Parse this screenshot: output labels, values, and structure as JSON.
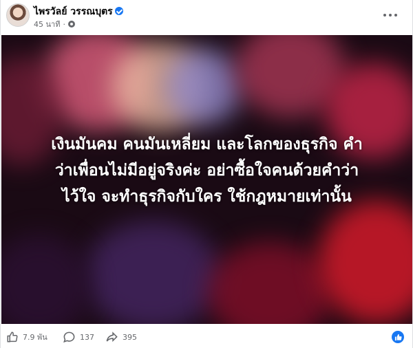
{
  "post": {
    "author": "ไพรวัลย์ วรรณบุตร",
    "time": "45 นาที",
    "separator": "·",
    "image_text_lines": [
      "เงินมันคม คนมันเหลี่ยม และโลกของธุรกิจ คำ",
      "ว่าเพื่อนไม่มีอยู่จริงค่ะ อย่าซื้อใจคนด้วยคำว่า",
      "ไว้ใจ จะทำธุรกิจกับใคร ใช้กฎหมายเท่านั้น"
    ]
  },
  "stats": {
    "likes": "7.9 พัน",
    "comments": "137",
    "shares": "395"
  },
  "icons": {
    "verified": "verified-badge-icon",
    "privacy": "globe-icon",
    "more": "more-options-icon",
    "like": "thumbs-up-icon",
    "comment": "comment-bubble-icon",
    "share": "share-arrow-icon",
    "reaction": "like-reaction-icon"
  },
  "colors": {
    "accent": "#1877f2",
    "secondary_text": "#65676b"
  }
}
